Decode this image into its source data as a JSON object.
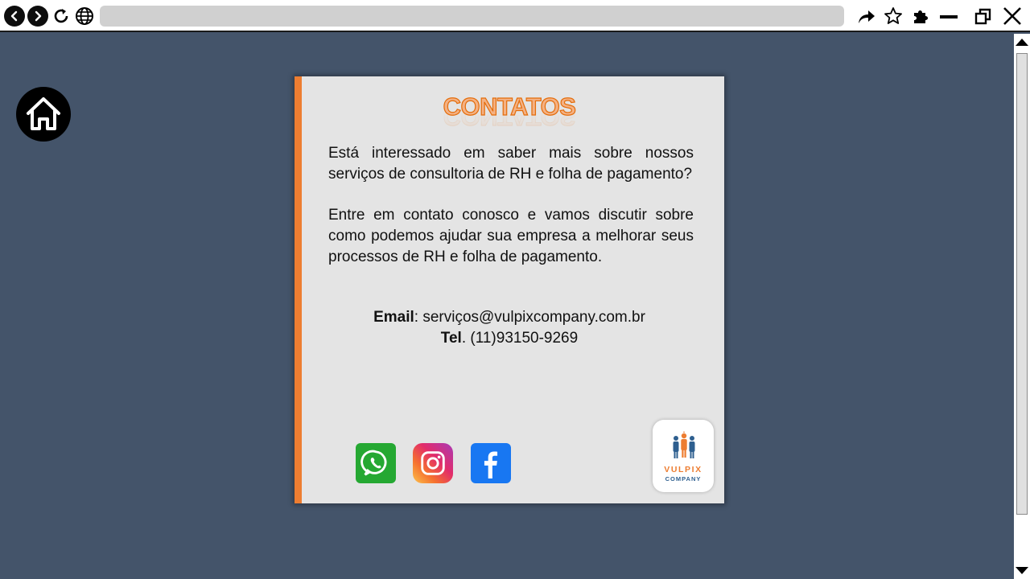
{
  "browser": {
    "address": "",
    "icons": [
      "back-icon",
      "forward-icon",
      "reload-icon",
      "globe-icon",
      "share-icon",
      "star-icon",
      "extensions-icon",
      "minimize-icon",
      "restore-icon",
      "close-icon"
    ]
  },
  "card": {
    "title": "CONTATOS",
    "paragraph1": "Está interessado em saber mais sobre nossos serviços de consultoria de RH e folha de pagamento?",
    "paragraph2": "Entre em contato conosco e vamos discutir sobre como podemos ajudar sua empresa a melhorar seus processos de RH e folha de pagamento.",
    "email_label": "Email",
    "email_value": ": serviços@vulpixcompany.com.br",
    "tel_label": "Tel",
    "tel_value": ". (11)93150-9269"
  },
  "social": [
    "whatsapp-icon",
    "instagram-icon",
    "facebook-icon"
  ],
  "logo": {
    "name": "VULPIX",
    "sub": "COMPANY"
  },
  "colors": {
    "background": "#44546a",
    "card": "#e4e4e4",
    "accent": "#ed7d31",
    "whatsapp": "#25a832",
    "facebook": "#1877f2"
  }
}
